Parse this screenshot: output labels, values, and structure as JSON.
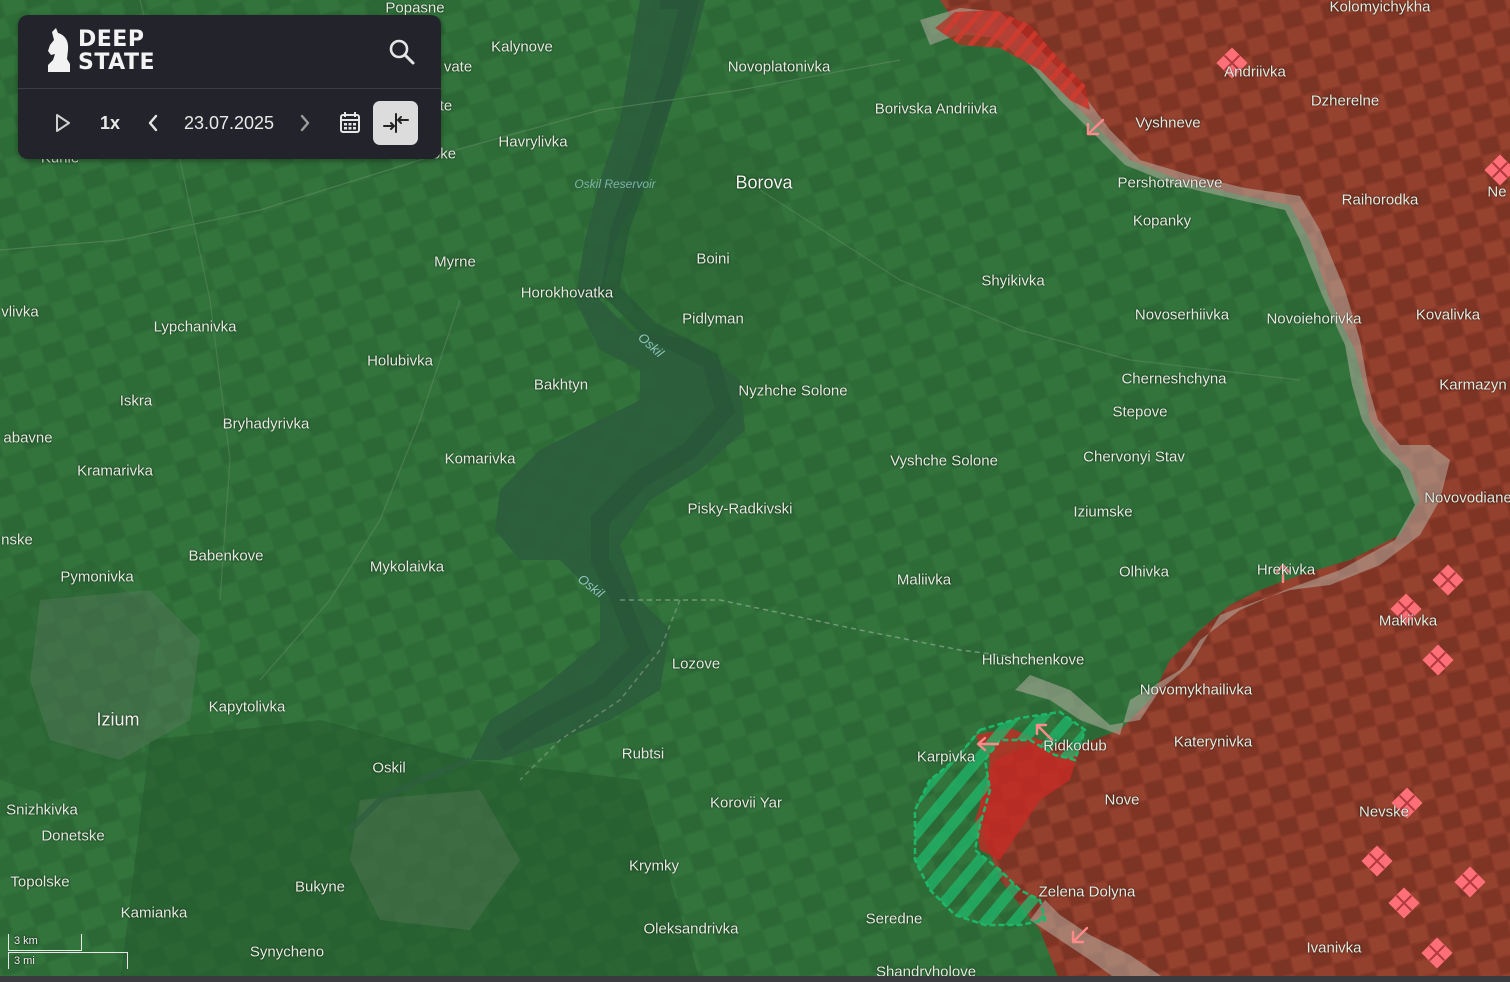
{
  "app": {
    "logo_line1": "DEEP",
    "logo_line2": "STATE",
    "search_icon": "search-icon"
  },
  "timeline": {
    "play_icon": "play-icon",
    "speed": "1x",
    "prev_icon": "chevron-left-icon",
    "date": "23.07.2025",
    "next_icon": "chevron-right-icon",
    "calendar_icon": "calendar-icon",
    "compare_icon": "compare-arrows-icon"
  },
  "scale": {
    "km": "3 km",
    "mi": "3 mi"
  },
  "colors": {
    "ukraine_controlled": "#2f6d39",
    "occupied": "#8b3a2a",
    "contested_gray": "#b7aea2",
    "recent_advance_red": "#c52a24",
    "liberated_green": "#1eb76a",
    "strike_marker": "#ff6f78"
  },
  "places": [
    {
      "name": "Popasne",
      "type": "town"
    },
    {
      "name": "Kalynove",
      "type": "town"
    },
    {
      "name": "Novoplatonivka",
      "type": "town"
    },
    {
      "name": "Kolomyichykha",
      "type": "town"
    },
    {
      "name": "Andriivka",
      "type": "town"
    },
    {
      "name": "vate",
      "type": "town"
    },
    {
      "name": "te",
      "type": "town"
    },
    {
      "name": "Borivska Andriivka",
      "type": "town"
    },
    {
      "name": "Dzherelne",
      "type": "town"
    },
    {
      "name": "Vyshneve",
      "type": "town"
    },
    {
      "name": "Havrylivka",
      "type": "town"
    },
    {
      "name": "Kunie",
      "type": "town"
    },
    {
      "name": "oke",
      "type": "town"
    },
    {
      "name": "Oskil Reservoir",
      "type": "water"
    },
    {
      "name": "Borova",
      "type": "city"
    },
    {
      "name": "Pershotravneve",
      "type": "town"
    },
    {
      "name": "Raihorodka",
      "type": "town"
    },
    {
      "name": "Ne",
      "type": "town"
    },
    {
      "name": "Kopanky",
      "type": "town"
    },
    {
      "name": "Boini",
      "type": "town"
    },
    {
      "name": "Myrne",
      "type": "town"
    },
    {
      "name": "Horokhovatka",
      "type": "town"
    },
    {
      "name": "Shyikivka",
      "type": "town"
    },
    {
      "name": "Pidlyman",
      "type": "town"
    },
    {
      "name": "Novoserhiivka",
      "type": "town"
    },
    {
      "name": "Novoiehorivka",
      "type": "town"
    },
    {
      "name": "Kovalivka",
      "type": "town"
    },
    {
      "name": "vlivka",
      "type": "town"
    },
    {
      "name": "Lypchanivka",
      "type": "town"
    },
    {
      "name": "Oskil",
      "type": "river"
    },
    {
      "name": "Holubivka",
      "type": "town"
    },
    {
      "name": "Bakhtyn",
      "type": "town"
    },
    {
      "name": "Nyzhche Solone",
      "type": "town"
    },
    {
      "name": "Cherneshchyna",
      "type": "town"
    },
    {
      "name": "Karmazyn",
      "type": "town"
    },
    {
      "name": "Iskra",
      "type": "town"
    },
    {
      "name": "Stepove",
      "type": "town"
    },
    {
      "name": "Bryhadyrivka",
      "type": "town"
    },
    {
      "name": "abavne",
      "type": "town"
    },
    {
      "name": "Komarivka",
      "type": "town"
    },
    {
      "name": "Chervonyi Stav",
      "type": "town"
    },
    {
      "name": "Vyshche Solone",
      "type": "town"
    },
    {
      "name": "Kramarivka",
      "type": "town"
    },
    {
      "name": "Novovodiane",
      "type": "town"
    },
    {
      "name": "Pisky-Radkivski",
      "type": "town"
    },
    {
      "name": "Iziumske",
      "type": "town"
    },
    {
      "name": "nske",
      "type": "town"
    },
    {
      "name": "Babenkove",
      "type": "town"
    },
    {
      "name": "Mykolaivka",
      "type": "town"
    },
    {
      "name": "Hrekivka",
      "type": "town"
    },
    {
      "name": "Olhivka",
      "type": "town"
    },
    {
      "name": "Pymonivka",
      "type": "town"
    },
    {
      "name": "Maliivka",
      "type": "town"
    },
    {
      "name": "Oskil",
      "type": "river"
    },
    {
      "name": "Makiivka",
      "type": "town"
    },
    {
      "name": "Hlushchenkove",
      "type": "town"
    },
    {
      "name": "Lozove",
      "type": "town"
    },
    {
      "name": "Novomykhailivka",
      "type": "town"
    },
    {
      "name": "Kapytolivka",
      "type": "town"
    },
    {
      "name": "Izium",
      "type": "city"
    },
    {
      "name": "Ridkodub",
      "type": "town"
    },
    {
      "name": "Katerynivka",
      "type": "town"
    },
    {
      "name": "Karpivka",
      "type": "town"
    },
    {
      "name": "Rubtsi",
      "type": "town"
    },
    {
      "name": "Oskil",
      "type": "town"
    },
    {
      "name": "Nove",
      "type": "town"
    },
    {
      "name": "Korovii Yar",
      "type": "town"
    },
    {
      "name": "Nevske",
      "type": "town"
    },
    {
      "name": "Snizhkivka",
      "type": "town"
    },
    {
      "name": "Donetske",
      "type": "town"
    },
    {
      "name": "Krymky",
      "type": "town"
    },
    {
      "name": "Zelena Dolyna",
      "type": "town"
    },
    {
      "name": "Topolske",
      "type": "town"
    },
    {
      "name": "Bukyne",
      "type": "town"
    },
    {
      "name": "Seredne",
      "type": "town"
    },
    {
      "name": "Kamianka",
      "type": "town"
    },
    {
      "name": "Oleksandrivka",
      "type": "town"
    },
    {
      "name": "Ivanivka",
      "type": "town"
    },
    {
      "name": "Synycheno",
      "type": "town"
    },
    {
      "name": "Shandryholove",
      "type": "town"
    }
  ]
}
